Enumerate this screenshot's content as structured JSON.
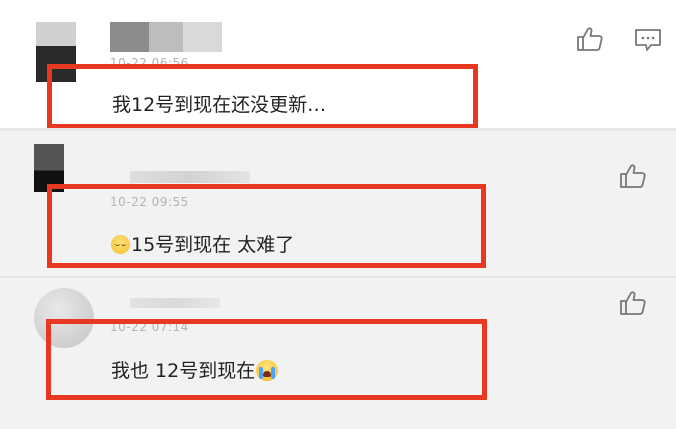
{
  "comments": [
    {
      "timestamp": "10-22 06:56",
      "text": "我12号到现在还没更新…"
    },
    {
      "timestamp": "10-22 09:55",
      "text": "15号到现在 太难了",
      "emoji": "sleepy-face"
    },
    {
      "timestamp": "10-22 07:14",
      "text_prefix": "我也 12号到现在",
      "emoji": "loudly-crying-face"
    }
  ],
  "icons": {
    "like": "thumbs-up-icon",
    "reply": "comment-icon"
  },
  "colors": {
    "highlight_box": "#e8381f",
    "comment_text": "#222222",
    "timestamp": "#b3b3b3",
    "reply_bg": "#f2f2f2"
  }
}
